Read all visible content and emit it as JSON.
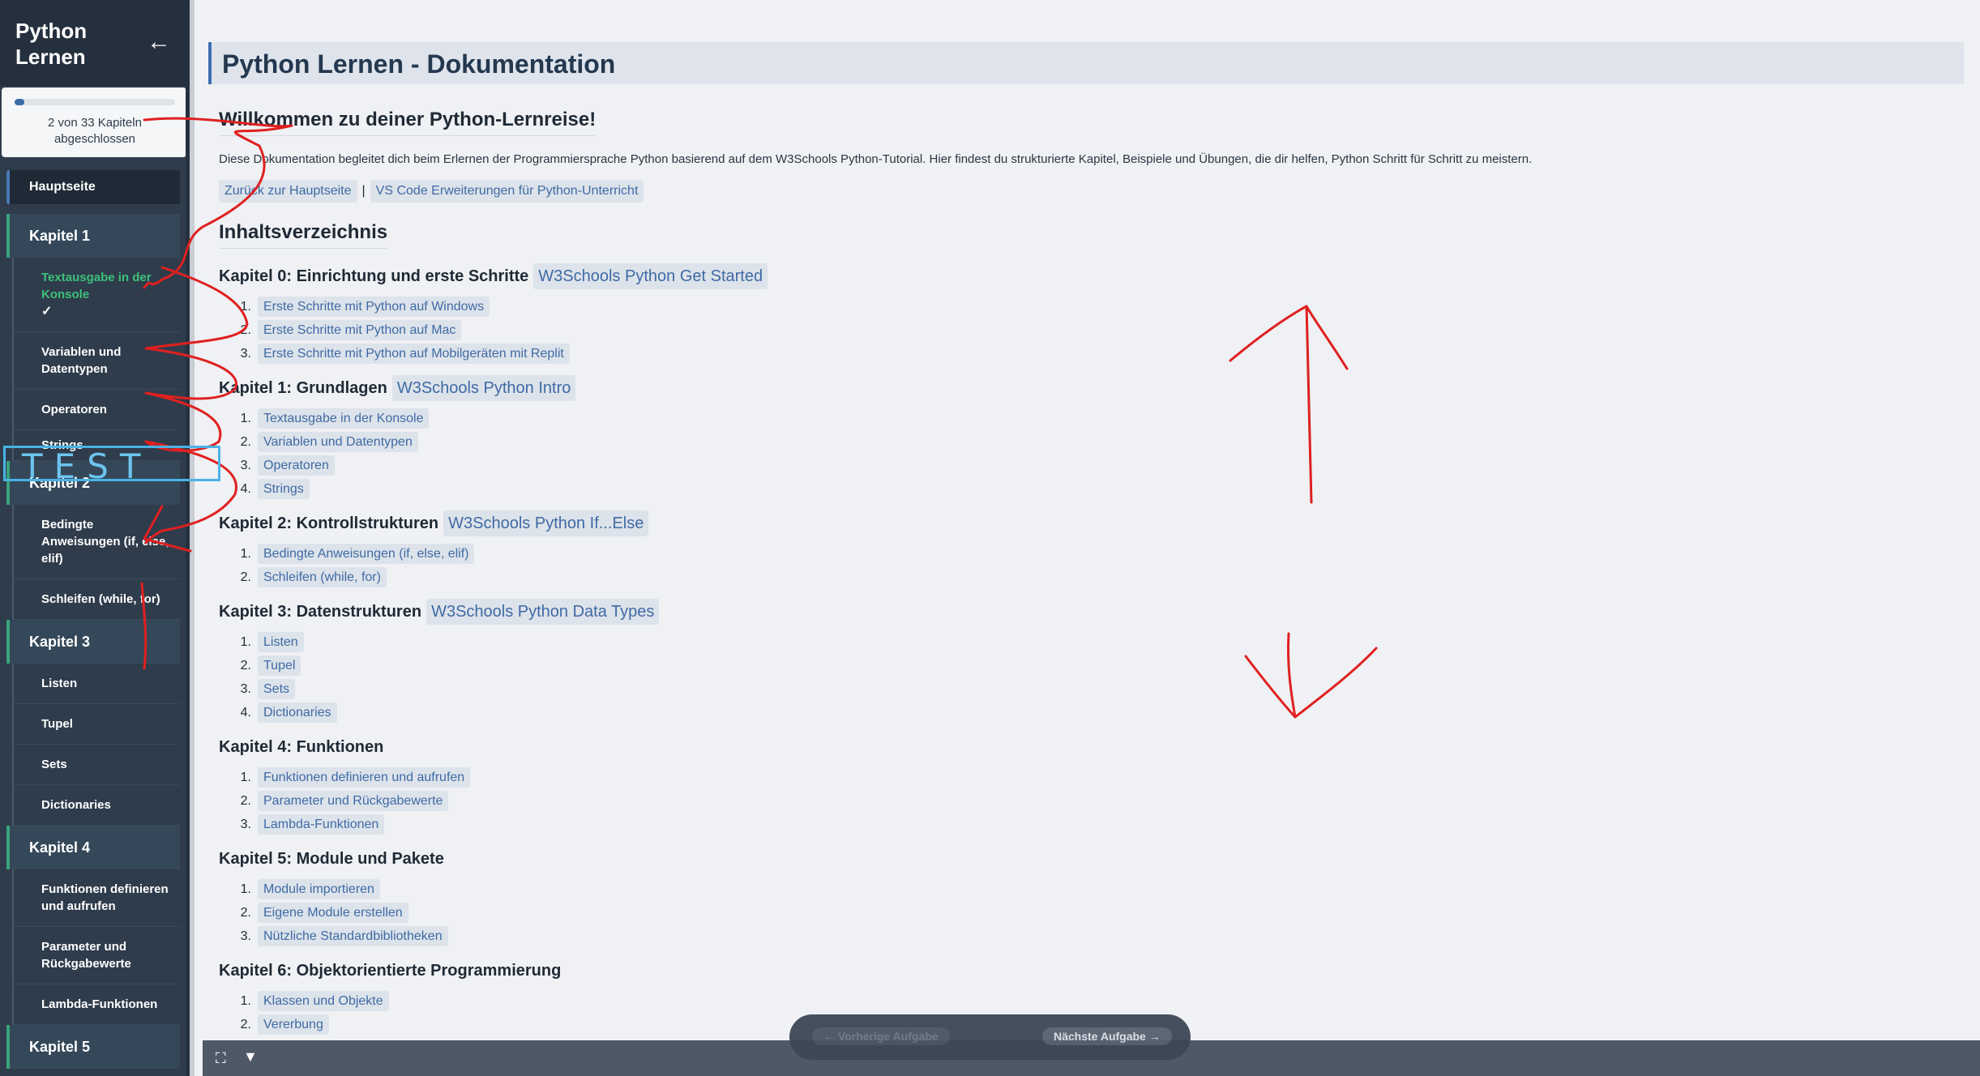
{
  "app": {
    "title": "Python Lernen",
    "collapse_icon": "arrow-left-icon"
  },
  "progress": {
    "completed": 2,
    "total": 33,
    "fraction": 0.0606,
    "text": "2 von 33 Kapiteln abgeschlossen"
  },
  "sidebar": {
    "home": "Hauptseite",
    "chapters": [
      {
        "label": "Kapitel 1",
        "items": [
          {
            "label": "Textausgabe in der Konsole",
            "active": true,
            "check": "✓"
          },
          {
            "label": "Variablen und Datentypen"
          },
          {
            "label": "Operatoren"
          },
          {
            "label": "Strings"
          }
        ]
      },
      {
        "label": "Kapitel 2",
        "items": [
          {
            "label": "Bedingte Anweisungen (if, else, elif)"
          },
          {
            "label": "Schleifen (while, for)"
          }
        ]
      },
      {
        "label": "Kapitel 3",
        "items": [
          {
            "label": "Listen"
          },
          {
            "label": "Tupel"
          },
          {
            "label": "Sets"
          },
          {
            "label": "Dictionaries"
          }
        ]
      },
      {
        "label": "Kapitel 4",
        "items": [
          {
            "label": "Funktionen definieren und aufrufen"
          },
          {
            "label": "Parameter und Rückgabewerte"
          },
          {
            "label": "Lambda-Funktionen"
          }
        ]
      },
      {
        "label": "Kapitel 5",
        "items": []
      }
    ]
  },
  "main": {
    "title": "Python Lernen - Dokumentation",
    "welcome_heading": "Willkommen zu deiner Python-Lernreise!",
    "intro": "Diese Dokumentation begleitet dich beim Erlernen der Programmiersprache Python basierend auf dem W3Schools Python-Tutorial. Hier findest du strukturierte Kapitel, Beispiele und Übungen, die dir helfen, Python Schritt für Schritt zu meistern.",
    "links": {
      "back": "Zurück zur Hauptseite",
      "separator": "|",
      "vscode": "VS Code Erweiterungen für Python-Unterricht"
    },
    "toc_heading": "Inhaltsverzeichnis",
    "chapters": [
      {
        "title": "Kapitel 0: Einrichtung und erste Schritte",
        "ref": "W3Schools Python Get Started",
        "items": [
          "Erste Schritte mit Python auf Windows",
          "Erste Schritte mit Python auf Mac",
          "Erste Schritte mit Python auf Mobilgeräten mit Replit"
        ]
      },
      {
        "title": "Kapitel 1: Grundlagen",
        "ref": "W3Schools Python Intro",
        "items": [
          "Textausgabe in der Konsole",
          "Variablen und Datentypen",
          "Operatoren",
          "Strings"
        ]
      },
      {
        "title": "Kapitel 2: Kontrollstrukturen",
        "ref": "W3Schools Python If...Else",
        "items": [
          "Bedingte Anweisungen (if, else, elif)",
          "Schleifen (while, for)"
        ]
      },
      {
        "title": "Kapitel 3: Datenstrukturen",
        "ref": "W3Schools Python Data Types",
        "items": [
          "Listen",
          "Tupel",
          "Sets",
          "Dictionaries"
        ]
      },
      {
        "title": "Kapitel 4: Funktionen",
        "ref": "",
        "items": [
          "Funktionen definieren und aufrufen",
          "Parameter und Rückgabewerte",
          "Lambda-Funktionen"
        ]
      },
      {
        "title": "Kapitel 5: Module und Pakete",
        "ref": "",
        "items": [
          "Module importieren",
          "Eigene Module erstellen",
          "Nützliche Standardbibliotheken"
        ]
      },
      {
        "title": "Kapitel 6: Objektorientierte Programmierung",
        "ref": "",
        "items": [
          "Klassen und Objekte",
          "Vererbung"
        ]
      }
    ]
  },
  "task_nav": {
    "prev": "← Vorherige Aufgabe",
    "next": "Nächste Aufgabe →"
  },
  "bottom_bar": {
    "fullscreen_icon": "⛶",
    "down_icon": "▼"
  },
  "annotation": {
    "label": "TEST",
    "color": "#e02020",
    "box_color": "#4ab3e6"
  }
}
